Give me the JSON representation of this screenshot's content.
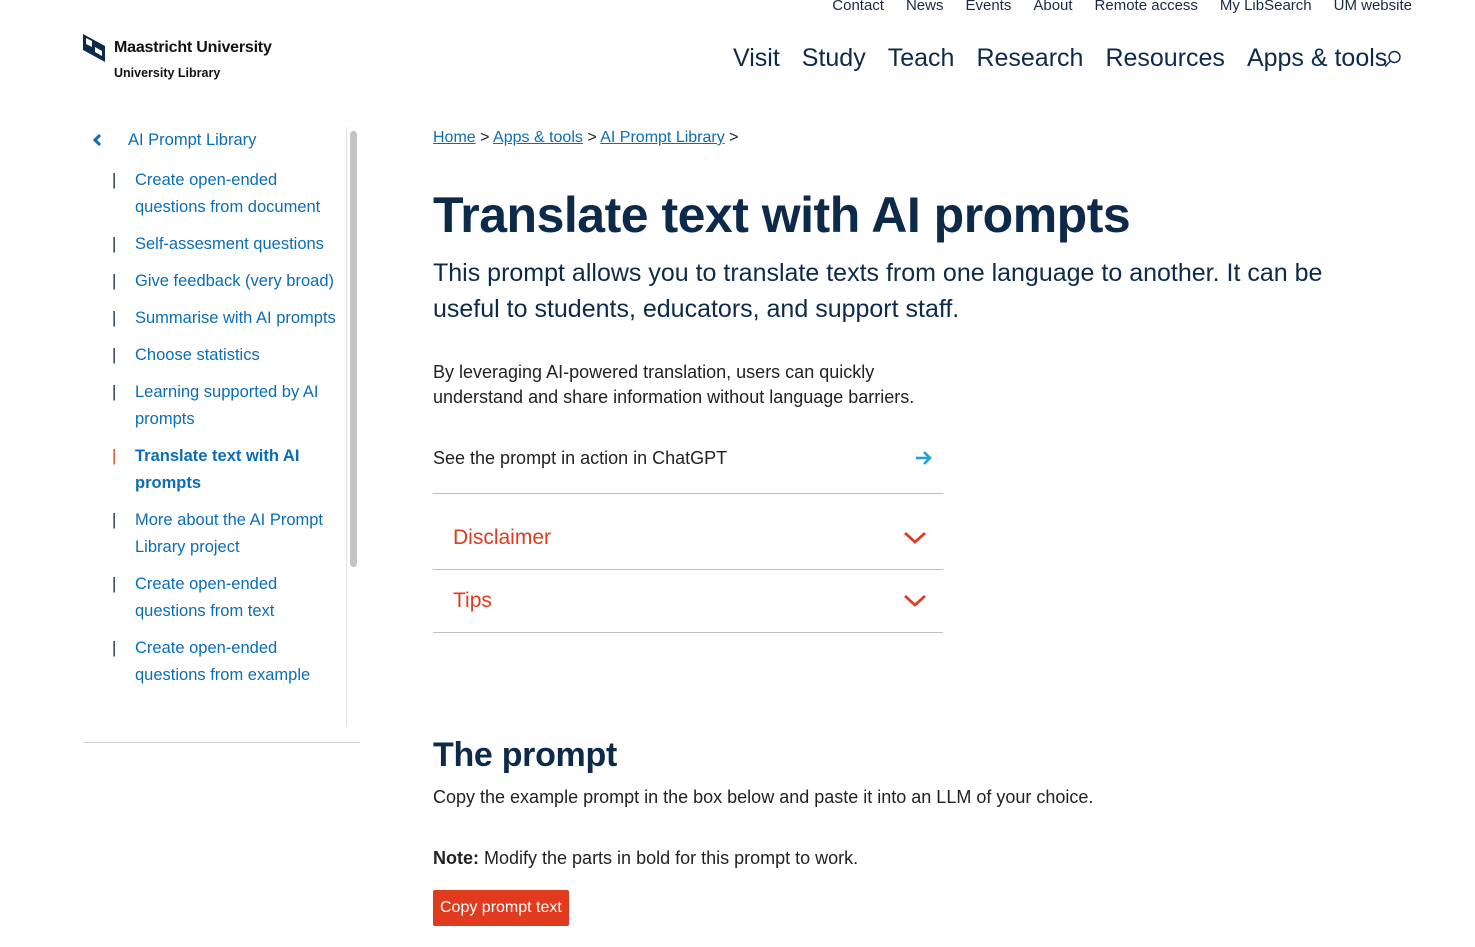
{
  "utility_nav": [
    "Contact",
    "News",
    "Events",
    "About",
    "Remote access",
    "My LibSearch",
    "UM website"
  ],
  "logo": {
    "university": "Maastricht University",
    "library": "University Library"
  },
  "main_nav": [
    "Visit",
    "Study",
    "Teach",
    "Research",
    "Resources",
    "Apps & tools"
  ],
  "sidebar": {
    "back_label": "AI Prompt Library",
    "items": [
      {
        "label": "Create open-ended questions from document"
      },
      {
        "label": "Self-assesment questions"
      },
      {
        "label": "Give feedback (very broad)"
      },
      {
        "label": "Summarise with AI prompts"
      },
      {
        "label": "Choose statistics"
      },
      {
        "label": "Learning supported by AI prompts"
      },
      {
        "label": "Translate text with AI prompts"
      },
      {
        "label": "More about the AI Prompt Library project"
      },
      {
        "label": "Create open-ended questions from text"
      },
      {
        "label": "Create open-ended questions from example"
      }
    ]
  },
  "breadcrumb": {
    "home": "Home",
    "apps": "Apps & tools",
    "library": "AI Prompt Library",
    "sep": ">"
  },
  "main": {
    "title": "Translate text with AI prompts",
    "lead": "This prompt allows you to translate texts from one language to another. It can be useful to students, educators, and support staff.",
    "intro": "By leveraging AI-powered translation, users can quickly understand and share information without language barriers.",
    "cta": "See the prompt in action in ChatGPT",
    "accordions": [
      "Disclaimer",
      "Tips"
    ],
    "prompt_heading": "The prompt",
    "prompt_text": "Copy the example prompt in the box below and paste it into an LLM of your choice.",
    "note_label": "Note:",
    "note_text": " Modify the parts in bold for this prompt to work.",
    "copy_button": "Copy prompt text"
  },
  "colors": {
    "navy": "#0d2a4a",
    "link": "#0b6db7",
    "accent": "#e03b1f",
    "arrow": "#1aa3d9"
  }
}
